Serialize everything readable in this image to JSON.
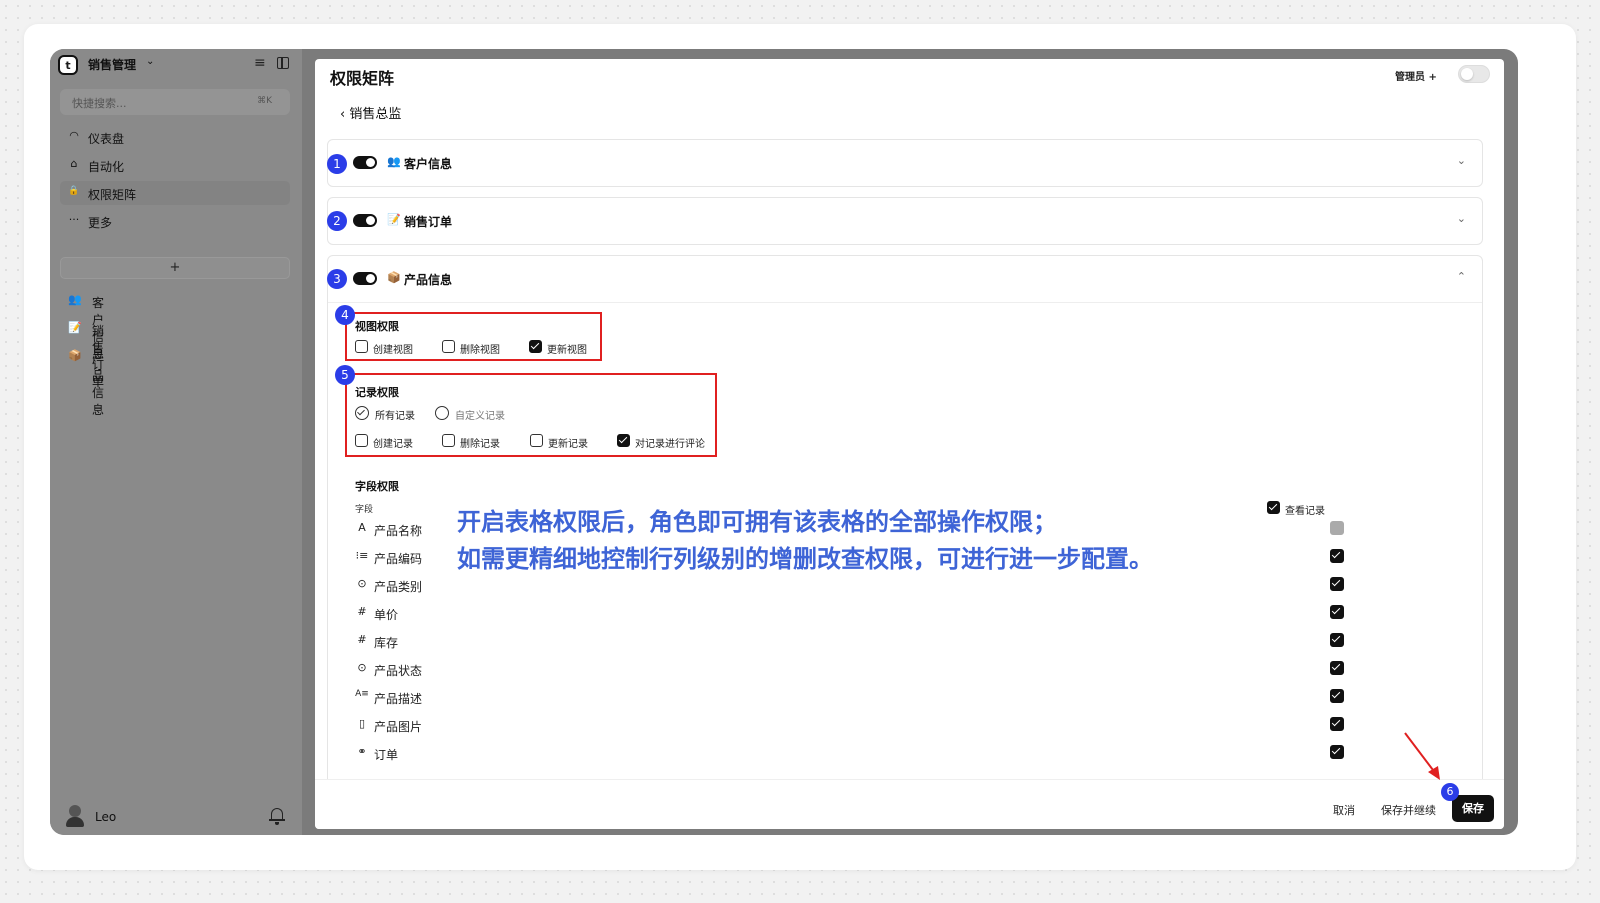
{
  "sidebar": {
    "app_icon": "t",
    "app_name": "销售管理",
    "search_placeholder": "快捷搜索...",
    "search_shortcut": "⌘K",
    "nav": [
      {
        "icon": "dashboard-icon",
        "glyph": "◠",
        "label": "仪表盘"
      },
      {
        "icon": "robot-icon",
        "glyph": "⌂",
        "label": "自动化"
      },
      {
        "icon": "lock-icon",
        "glyph": "🔒",
        "label": "权限矩阵"
      },
      {
        "icon": "more-icon",
        "glyph": "···",
        "label": "更多"
      }
    ],
    "add_label": "+",
    "tables": [
      {
        "emoji": "👥",
        "label": "客户信息"
      },
      {
        "emoji": "📝",
        "label": "销售订单"
      },
      {
        "emoji": "📦",
        "label": "产品信息"
      }
    ],
    "user_name": "Leo"
  },
  "main": {
    "title": "权限矩阵",
    "role_label": "管理员 +",
    "back_label": "销售总监",
    "sections": [
      {
        "badge": "1",
        "emoji": "👥",
        "label": "客户信息",
        "chevron": "⌄"
      },
      {
        "badge": "2",
        "emoji": "📝",
        "label": "销售订单",
        "chevron": "⌄"
      },
      {
        "badge": "3",
        "emoji": "📦",
        "label": "产品信息",
        "chevron": "⌃"
      }
    ],
    "view_perm": {
      "badge": "4",
      "title": "视图权限",
      "items": [
        {
          "label": "创建视图",
          "checked": false
        },
        {
          "label": "删除视图",
          "checked": false
        },
        {
          "label": "更新视图",
          "checked": true
        }
      ]
    },
    "record_perm": {
      "badge": "5",
      "title": "记录权限",
      "radios": [
        {
          "label": "所有记录",
          "checked": true
        },
        {
          "label": "自定义记录",
          "checked": false
        }
      ],
      "items": [
        {
          "label": "创建记录",
          "checked": false
        },
        {
          "label": "删除记录",
          "checked": false
        },
        {
          "label": "更新记录",
          "checked": false
        },
        {
          "label": "对记录进行评论",
          "checked": true
        }
      ]
    },
    "field_perm": {
      "title": "字段权限",
      "col_header": "字段",
      "view_record_label": "查看记录",
      "fields": [
        {
          "icon": "text-icon",
          "glyph": "A",
          "label": "产品名称",
          "state": "gray"
        },
        {
          "icon": "list-icon",
          "glyph": "⁝≡",
          "label": "产品编码",
          "state": "checked"
        },
        {
          "icon": "select-icon",
          "glyph": "⊙",
          "label": "产品类别",
          "state": "checked"
        },
        {
          "icon": "number-icon",
          "glyph": "#",
          "label": "单价",
          "state": "checked"
        },
        {
          "icon": "number-icon",
          "glyph": "#",
          "label": "库存",
          "state": "checked"
        },
        {
          "icon": "select-icon",
          "glyph": "⊙",
          "label": "产品状态",
          "state": "checked"
        },
        {
          "icon": "richtext-icon",
          "glyph": "A≡",
          "label": "产品描述",
          "state": "checked"
        },
        {
          "icon": "file-icon",
          "glyph": "▯",
          "label": "产品图片",
          "state": "checked"
        },
        {
          "icon": "link-icon",
          "glyph": "⚭",
          "label": "订单",
          "state": "checked"
        }
      ]
    },
    "annotation_lines": [
      "开启表格权限后，角色即可拥有该表格的全部操作权限；",
      "如需更精细地控制行列级别的增删改查权限，可进行进一步配置。"
    ],
    "footer": {
      "cancel": "取消",
      "save_continue": "保存并继续",
      "save_badge": "6",
      "save": "保存"
    }
  },
  "colors": {
    "badge": "#2b3de8",
    "highlight": "#e02020",
    "annotation": "#3e64d6"
  }
}
